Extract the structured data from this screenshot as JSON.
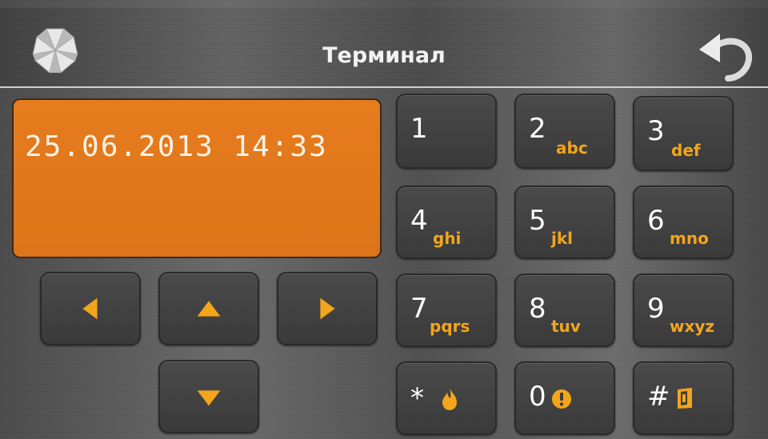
{
  "header": {
    "title": "Терминал",
    "logo_icon": "asterisk-logo-icon",
    "back_icon": "back-arrow-icon"
  },
  "display": {
    "text": "25.06.2013 14:33"
  },
  "keypad": {
    "k1": {
      "num": "1",
      "sub": ""
    },
    "k2": {
      "num": "2",
      "sub": "abc"
    },
    "k3": {
      "num": "3",
      "sub": "def"
    },
    "k4": {
      "num": "4",
      "sub": "ghi"
    },
    "k5": {
      "num": "5",
      "sub": "jkl"
    },
    "k6": {
      "num": "6",
      "sub": "mno"
    },
    "k7": {
      "num": "7",
      "sub": "pqrs"
    },
    "k8": {
      "num": "8",
      "sub": "tuv"
    },
    "k9": {
      "num": "9",
      "sub": "wxyz"
    },
    "kstar": {
      "num": "*",
      "icon": "fire-icon"
    },
    "k0": {
      "num": "0",
      "icon": "exclamation-icon"
    },
    "khash": {
      "num": "#",
      "icon": "shield-icon"
    }
  },
  "arrows": [
    "left-arrow-icon",
    "up-arrow-icon",
    "right-arrow-icon",
    "down-arrow-icon"
  ],
  "colors": {
    "accent": "#f3a51b",
    "display_bg": "#e07a1c",
    "key_bg": "#404040"
  }
}
